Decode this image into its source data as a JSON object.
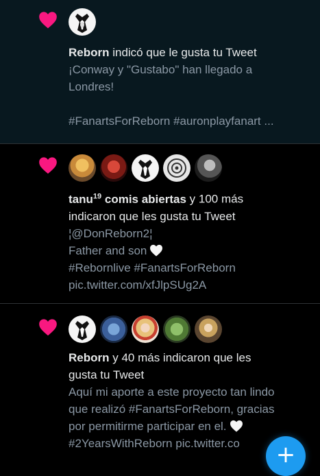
{
  "notifications": [
    {
      "actor": "Reborn",
      "action": " indicó que le gusta tu Tweet",
      "tweet_lines": [
        "¡Conway y \"Gustabo\" han llegado a",
        "Londres!"
      ],
      "hashtags": "#FanartsForReborn #auronplayfanart ...",
      "avatars": [
        "reborn-avatar"
      ]
    },
    {
      "actor": "tanu",
      "actor_sup": "19",
      "actor_rest": " comis abiertas",
      "action": " y 100 más",
      "action_line2": "indicaron que les gusta tu Tweet",
      "tweet_lines": [
        "¦@DonReborn2¦",
        "Father and son"
      ],
      "hashtags": "#Rebornlive #FanartsForReborn",
      "link": "pic.twitter.com/xfJlpSUg2A",
      "avatars": [
        "tanu-avatar",
        "red-character-avatar",
        "reborn-avatar",
        "circle-emblem-avatar",
        "grayscale-avatar"
      ]
    },
    {
      "actor": "Reborn",
      "action": " y 40 más indicaron que les",
      "action_line2": "gusta tu Tweet",
      "tweet_lines": [
        "Aquí mi aporte a este proyecto tan lindo",
        "que realizó #FanartsForReborn, gracias",
        "por permitirme participar en el."
      ],
      "hashtags": "#2YearsWithReborn pic.twitter.co",
      "avatars": [
        "reborn-avatar",
        "blue-cartoon-avatar",
        "blonde-girl-avatar",
        "green-frog-avatar",
        "curly-hair-avatar"
      ]
    }
  ],
  "compose_button": {
    "glyph": "+"
  },
  "colors": {
    "like_pink": "#f91880",
    "accent_blue": "#1d9bf0",
    "muted_text": "#8b98a5"
  }
}
